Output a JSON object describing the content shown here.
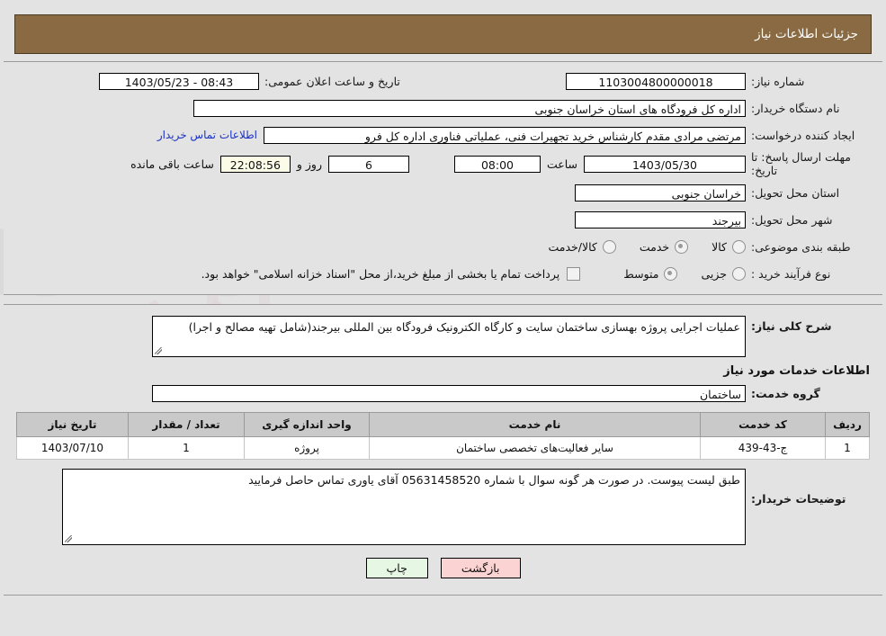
{
  "header": {
    "title": "جزئیات اطلاعات نیاز"
  },
  "need": {
    "number_label": "شماره نیاز:",
    "number_value": "1103004800000018",
    "announce_label": "تاریخ و ساعت اعلان عمومی:",
    "announce_value": "08:43 - 1403/05/23",
    "buyer_org_label": "نام دستگاه خریدار:",
    "buyer_org_value": "اداره کل فرودگاه های استان خراسان جنوبی",
    "creator_label": "ایجاد کننده درخواست:",
    "creator_value": "مرتضی مرادی مقدم کارشناس خرید تجهیرات فنی، عملیاتی فناوری اداره کل فرو",
    "contact_link": "اطلاعات تماس خریدار",
    "deadline_label": "مهلت ارسال پاسخ: تا تاریخ:",
    "deadline_date": "1403/05/30",
    "deadline_hour_label": "ساعت",
    "deadline_hour": "08:00",
    "days_remaining": "6",
    "days_word": "روز و",
    "timer": "22:08:56",
    "hours_remaining_label": "ساعت باقی مانده",
    "province_label": "استان محل تحویل:",
    "province_value": "خراسان جنوبی",
    "city_label": "شهر محل تحویل:",
    "city_value": "بیرجند",
    "category_label": "طبقه بندی موضوعی:",
    "category_options": [
      {
        "label": "کالا",
        "selected": false
      },
      {
        "label": "خدمت",
        "selected": true
      },
      {
        "label": "کالا/خدمت",
        "selected": false
      }
    ],
    "process_label": "نوع فرآیند خرید :",
    "process_options": [
      {
        "label": "جزیی",
        "selected": false
      },
      {
        "label": "متوسط",
        "selected": true
      }
    ],
    "treasury_note": "پرداخت تمام یا بخشی از مبلغ خرید،از محل \"اسناد خزانه اسلامی\" خواهد بود."
  },
  "description": {
    "label": "شرح کلی نیاز:",
    "value": "عملیات اجرایی پروژه بهسازی ساختمان سایت و کارگاه الکترونیک فرودگاه بین المللی بیرجند(شامل تهیه مصالح و اجرا)"
  },
  "services": {
    "section_title": "اطلاعات خدمات مورد نیاز",
    "group_label": "گروه خدمت:",
    "group_value": "ساختمان",
    "columns": [
      "ردیف",
      "کد خدمت",
      "نام خدمت",
      "واحد اندازه گیری",
      "تعداد / مقدار",
      "تاریخ نیاز"
    ],
    "rows": [
      {
        "row_no": "1",
        "code": "ج-43-439",
        "name": "سایر فعالیت‌های تخصصی ساختمان",
        "unit": "پروژه",
        "qty": "1",
        "need_date": "1403/07/10"
      }
    ]
  },
  "buyer_notes": {
    "label": "توضیحات خریدار:",
    "value": "طبق لیست پیوست. در صورت هر گونه سوال با شماره 05631458520 آقای یاوری تماس حاصل فرمایید"
  },
  "footer": {
    "back_label": "بازگشت",
    "print_label": "چاپ"
  },
  "colors": {
    "header_bg": "#8a6a42",
    "page_bg": "#e3e3e3",
    "link": "#1a32c8",
    "back_btn": "#fbd3d3",
    "print_btn": "#e6f7e3",
    "timer_bg": "#fbfbe8"
  },
  "watermark": {
    "text": "AnaTender.net"
  }
}
